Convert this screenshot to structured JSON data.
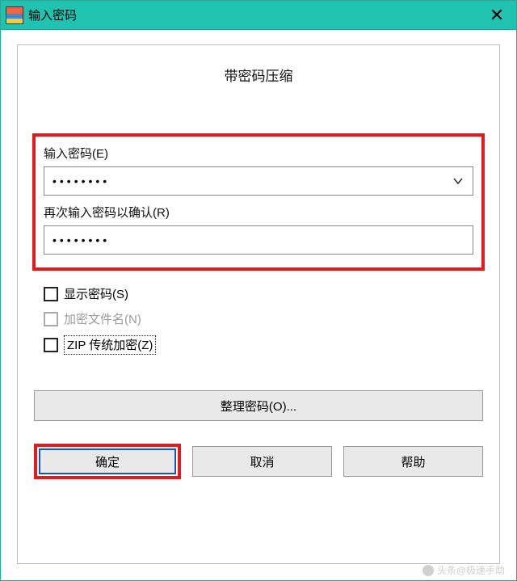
{
  "titlebar": {
    "title": "输入密码"
  },
  "dialog": {
    "heading": "带密码压缩"
  },
  "password": {
    "label": "输入密码(E)",
    "value": "••••••••",
    "confirm_label": "再次输入密码以确认(R)",
    "confirm_value": "••••••••"
  },
  "checkboxes": {
    "show_password": {
      "label": "显示密码(S)",
      "checked": false,
      "enabled": true
    },
    "encrypt_filenames": {
      "label": "加密文件名(N)",
      "checked": false,
      "enabled": false
    },
    "zip_legacy": {
      "label": "ZIP 传统加密(Z)",
      "checked": false,
      "enabled": true
    }
  },
  "buttons": {
    "organize": "整理密码(O)...",
    "ok": "确定",
    "cancel": "取消",
    "help": "帮助"
  },
  "watermark": "头条@极速手助"
}
